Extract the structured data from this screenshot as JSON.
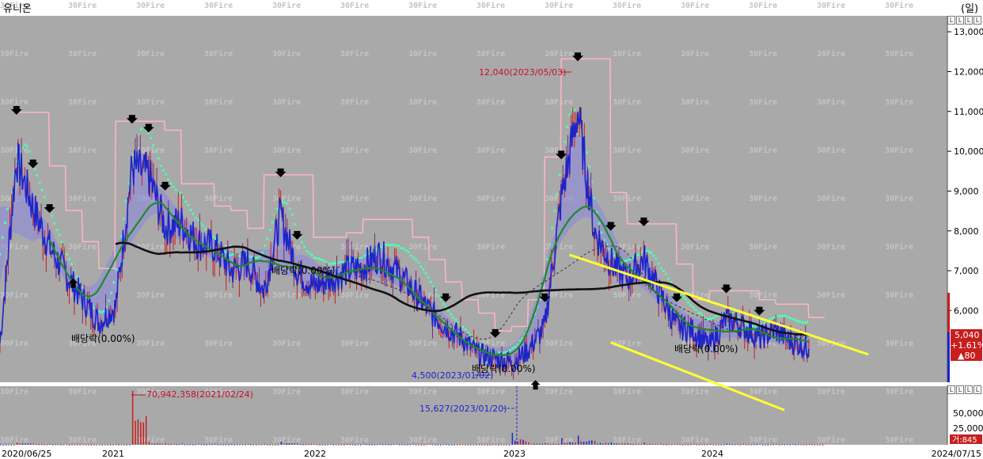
{
  "app": {
    "stock_name": "유니온",
    "period_label": "(일)"
  },
  "watermark": "30Fire",
  "colors": {
    "plot_bg": "#a9a9a9",
    "price_line": "#1d25c9",
    "candle_up": "#c81e1e",
    "ma_black": "#111111",
    "ma_green": "#1d8a2a",
    "parabolic": "#4dffb0",
    "channel": "#ffff33",
    "box_line": "#ffb6c1",
    "cloud": "#8a86e0",
    "label_red": "#c8102e",
    "label_blue": "#2222cc"
  },
  "price_axis": {
    "ticks": [
      "13,000",
      "12,000",
      "11,000",
      "10,000",
      "9,000",
      "8,000",
      "7,000",
      "6,000"
    ],
    "min": 4200,
    "max": 13400
  },
  "current": {
    "price": "5,040",
    "change_pct": "+1.61%",
    "change_abs": "▲80"
  },
  "volume_axis": {
    "ticks": [
      "50,000,",
      "25,000,"
    ],
    "current": "거:845"
  },
  "x_axis": {
    "labels": [
      "2020/06/25",
      "2021",
      "2022",
      "2023",
      "2024",
      "2024/07/15"
    ]
  },
  "annotations": {
    "high": "12,040(2023/05/03)",
    "low": "4,500(2023/01/02)",
    "vol_high": "70,942,358(2021/02/24)",
    "vol_low": "15,627(2023/01/20)",
    "dividends": [
      "배당락(0.00%)",
      "배당락(0.00%)",
      "배당락(0.00%)",
      "배당락(0.00%)"
    ]
  },
  "side_buttons": {
    "top": [
      "L",
      "L",
      "L",
      "L"
    ],
    "bottom": [
      "L",
      "L",
      "L",
      "L"
    ]
  },
  "chart_data": {
    "type": "line",
    "title": "유니온",
    "x": [
      "2020-06",
      "2020-07",
      "2020-08",
      "2020-09",
      "2020-10",
      "2020-11",
      "2020-12",
      "2021-01",
      "2021-02",
      "2021-03",
      "2021-04",
      "2021-05",
      "2021-06",
      "2021-07",
      "2021-08",
      "2021-09",
      "2021-10",
      "2021-11",
      "2021-12",
      "2022-01",
      "2022-02",
      "2022-03",
      "2022-04",
      "2022-05",
      "2022-06",
      "2022-07",
      "2022-08",
      "2022-09",
      "2022-10",
      "2022-11",
      "2022-12",
      "2023-01",
      "2023-02",
      "2023-03",
      "2023-04",
      "2023-05",
      "2023-06",
      "2023-07",
      "2023-08",
      "2023-09",
      "2023-10",
      "2023-11",
      "2023-12",
      "2024-01",
      "2024-02",
      "2024-03",
      "2024-04",
      "2024-05",
      "2024-06",
      "2024-07"
    ],
    "series": [
      {
        "values": [
          5200,
          9800,
          8600,
          7600,
          6900,
          6300,
          5700,
          6100,
          9600,
          9400,
          8100,
          8200,
          7700,
          7600,
          7000,
          7200,
          6500,
          8400,
          7000,
          6600,
          6800,
          7000,
          7100,
          7400,
          7000,
          6500,
          6000,
          5600,
          5300,
          4900,
          4800,
          4700,
          5000,
          5600,
          8800,
          11000,
          8000,
          7200,
          6800,
          7300,
          6400,
          5600,
          5500,
          5100,
          5800,
          5600,
          5300,
          5500,
          5200,
          5040
        ]
      }
    ],
    "ylim": [
      4200,
      13400
    ],
    "volume": {
      "values_k": [
        400,
        3000,
        1500,
        900,
        600,
        500,
        400,
        600,
        70942,
        4000,
        2000,
        1500,
        1200,
        1000,
        800,
        900,
        700,
        4000,
        1500,
        900,
        800,
        900,
        1000,
        1200,
        900,
        800,
        700,
        600,
        500,
        450,
        400,
        15627,
        3000,
        2500,
        9000,
        12000,
        5000,
        3000,
        2000,
        2500,
        1500,
        1000,
        900,
        800,
        1400,
        1000,
        900,
        1100,
        800,
        845
      ]
    }
  }
}
